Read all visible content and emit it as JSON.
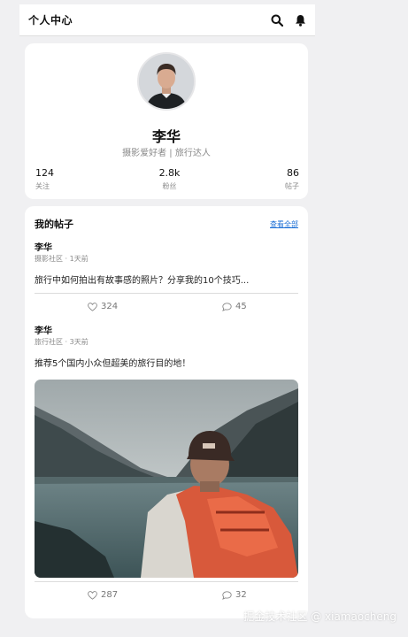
{
  "header": {
    "title": "个人中心",
    "icons": [
      "search-icon",
      "bell-icon"
    ]
  },
  "profile": {
    "name": "李华",
    "tagline": "摄影爱好者 | 旅行达人",
    "stats": [
      {
        "value": "124",
        "label": "关注"
      },
      {
        "value": "2.8k",
        "label": "粉丝"
      },
      {
        "value": "86",
        "label": "帖子"
      }
    ]
  },
  "posts_section": {
    "title": "我的帖子",
    "view_all": "查看全部",
    "posts": [
      {
        "author": "李华",
        "meta": "摄影社区 · 1天前",
        "text": "旅行中如何拍出有故事感的照片？分享我的10个技巧...",
        "likes": "324",
        "comments": "45"
      },
      {
        "author": "李华",
        "meta": "旅行社区 · 3天前",
        "text": "推荐5个国内小众但超美的旅行目的地！",
        "likes": "287",
        "comments": "32"
      }
    ]
  },
  "watermark": "掘金技术社区 @ xiamaocheng",
  "colors": {
    "background": "#f0f0f2",
    "card": "#ffffff",
    "link": "#1c6fd6",
    "muted": "#8a8a8a"
  }
}
